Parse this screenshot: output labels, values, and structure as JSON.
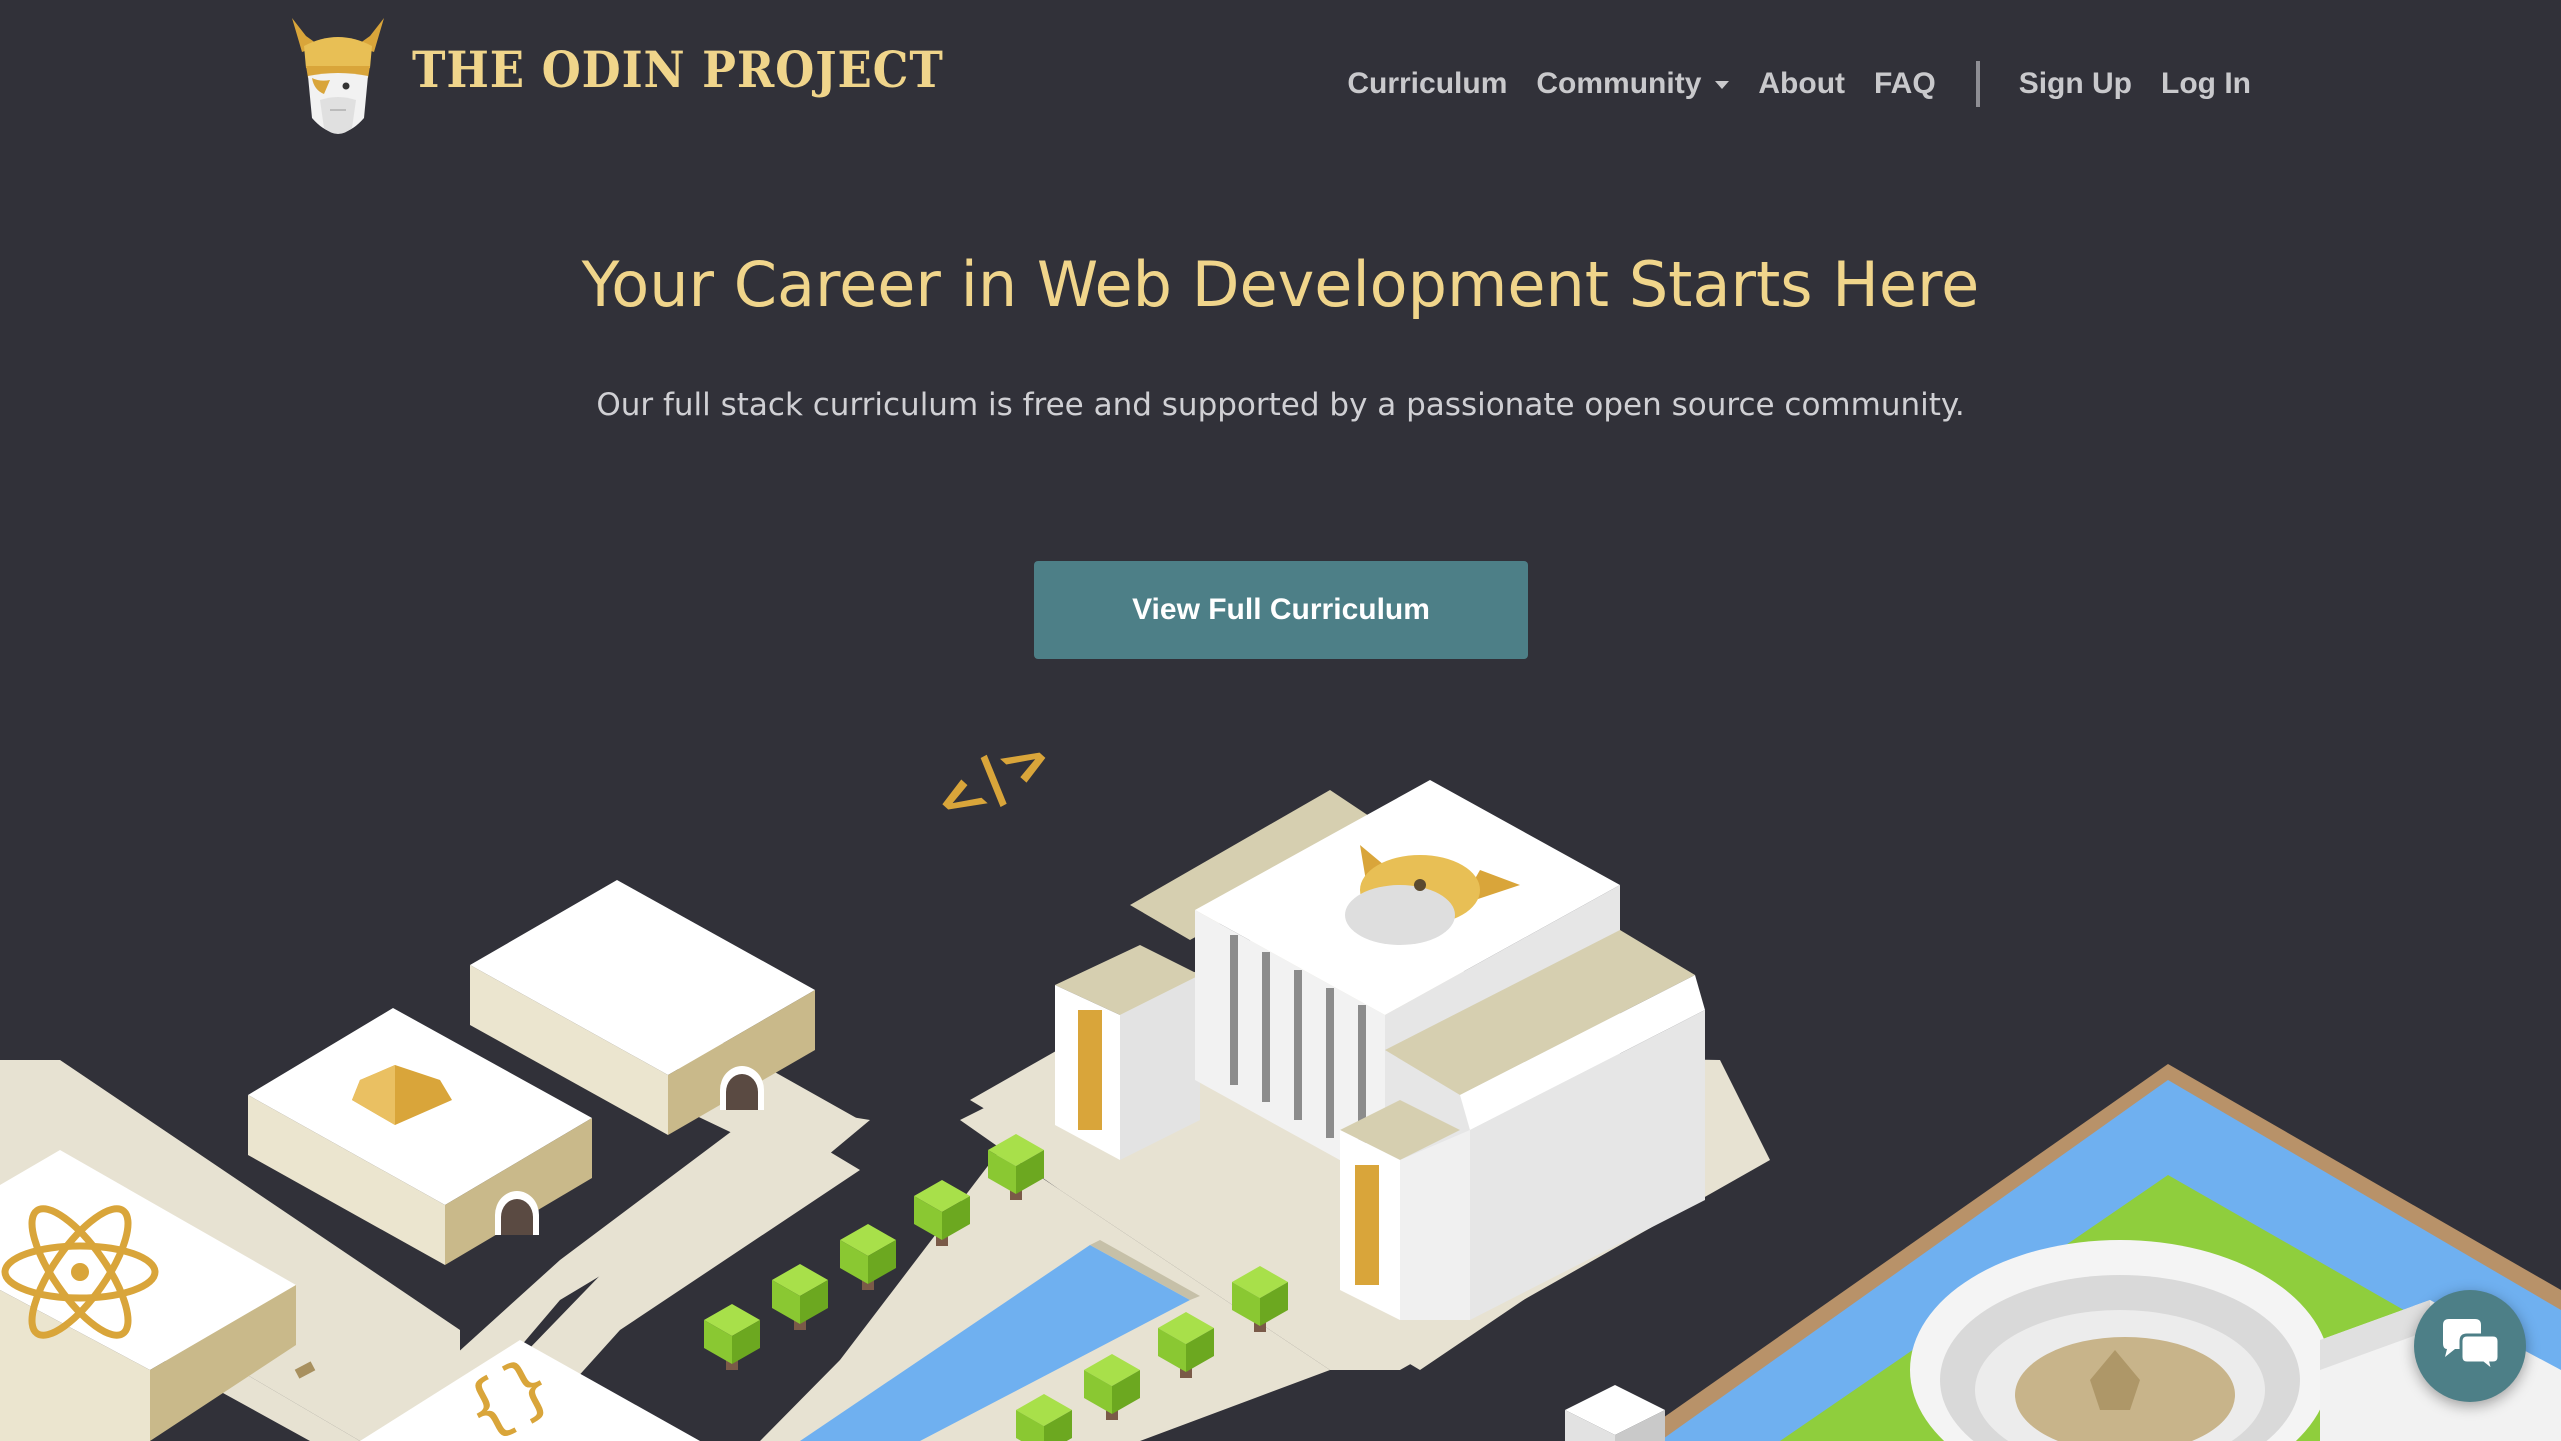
{
  "header": {
    "logo_text": "THE ODIN PROJECT",
    "logo_icon": "odin-viking-head-icon",
    "nav": [
      {
        "label": "Curriculum",
        "has_dropdown": false
      },
      {
        "label": "Community",
        "has_dropdown": true
      },
      {
        "label": "About",
        "has_dropdown": false
      },
      {
        "label": "FAQ",
        "has_dropdown": false
      },
      {
        "label": "Sign Up",
        "has_dropdown": false
      },
      {
        "label": "Log In",
        "has_dropdown": false
      }
    ]
  },
  "hero": {
    "title": "Your Career in Web Development Starts Here",
    "subtitle": "Our full stack curriculum is free and supported by a passionate open source community.",
    "cta_label": "View Full Curriculum"
  },
  "illustration": {
    "name": "isometric-campus-illustration",
    "buildings": [
      "react-atom-building",
      "code-tag-building",
      "ruby-gem-building",
      "curly-brace-building",
      "odin-temple",
      "colosseum"
    ]
  },
  "chat": {
    "icon": "chat-bubbles-icon"
  },
  "colors": {
    "background": "#313139",
    "accent_gold": "#f0d58b",
    "button_teal": "#4d7f87",
    "nav_text": "#c9c9cc"
  }
}
